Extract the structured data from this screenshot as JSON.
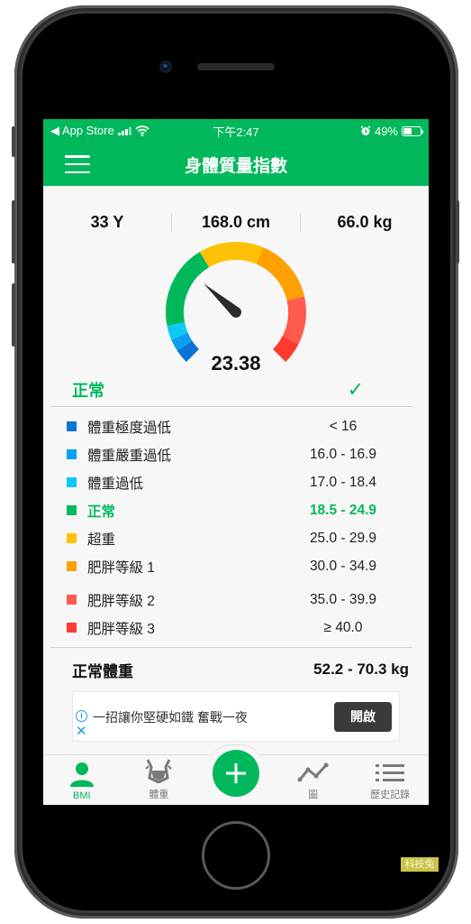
{
  "status_bar": {
    "back_app": "◀ App Store",
    "time": "下午2:47",
    "battery": "49%",
    "battery_level": 0.49
  },
  "app_bar": {
    "title": "身體質量指數",
    "menu_icon": "hamburger-menu-icon"
  },
  "stats": {
    "age": "33 Y",
    "height": "168.0 cm",
    "weight": "66.0 kg"
  },
  "gauge": {
    "value": "23.38",
    "bmi": 23.38,
    "segments": [
      {
        "color": "#0a73d8"
      },
      {
        "color": "#0aa0ef"
      },
      {
        "color": "#10c8f8"
      },
      {
        "color": "#00b85c"
      },
      {
        "color": "#ffc107"
      },
      {
        "color": "#ff9f00"
      },
      {
        "color": "#ff5a4b"
      },
      {
        "color": "#ff3b2f"
      }
    ]
  },
  "result": {
    "label": "正常",
    "check_icon": "✓"
  },
  "ranges": [
    {
      "name": "體重極度過低",
      "value": "< 16",
      "color": "#0a73d8"
    },
    {
      "name": "體重嚴重過低",
      "value": "16.0 - 16.9",
      "color": "#0aa0ef"
    },
    {
      "name": "體重過低",
      "value": "17.0 - 18.4",
      "color": "#10c8f8"
    },
    {
      "name": "正常",
      "value": "18.5 - 24.9",
      "color": "#00b85c"
    },
    {
      "name": "超重",
      "value": "25.0 - 29.9",
      "color": "#ffc107"
    },
    {
      "name": "肥胖等級 1",
      "value": "30.0 - 34.9",
      "color": "#ff9f00"
    },
    {
      "name": "肥胖等級 2",
      "value": "35.0 - 39.9",
      "color": "#ff5a4b"
    },
    {
      "name": "肥胖等級 3",
      "value": "≥ 40.0",
      "color": "#ff3b2f"
    }
  ],
  "normal_weight": {
    "label": "正常體重",
    "value": "52.2 - 70.3 kg"
  },
  "ad": {
    "text": "一招讓你堅硬如鐵 奮戰一夜",
    "button": "開啟",
    "info_icon": "i",
    "close_icon": "✕"
  },
  "tabs": [
    {
      "label": "BMI",
      "active": true
    },
    {
      "label": "體重",
      "active": false
    },
    {
      "label": "",
      "active": false
    },
    {
      "label": "圖",
      "active": false
    },
    {
      "label": "歷史記錄",
      "active": false
    }
  ],
  "watermark": "科技兔",
  "colors": {
    "accent": "#00b85c"
  }
}
